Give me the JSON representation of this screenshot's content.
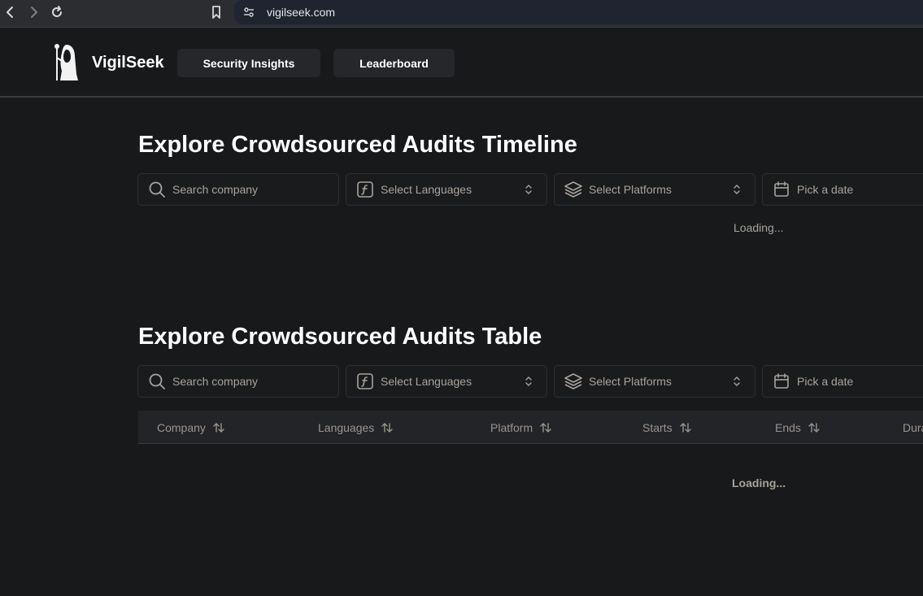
{
  "browser": {
    "url": "vigilseek.com"
  },
  "header": {
    "brand": "VigilSeek",
    "nav": [
      {
        "label": "Security Insights"
      },
      {
        "label": "Leaderboard"
      }
    ]
  },
  "timeline": {
    "title": "Explore Crowdsourced Audits Timeline",
    "search_placeholder": "Search company",
    "languages_label": "Select Languages",
    "platforms_label": "Select Platforms",
    "date_label": "Pick a date",
    "loading": "Loading..."
  },
  "table": {
    "title": "Explore Crowdsourced Audits Table",
    "search_placeholder": "Search company",
    "languages_label": "Select Languages",
    "platforms_label": "Select Platforms",
    "date_label": "Pick a date",
    "columns": [
      "Company",
      "Languages",
      "Platform",
      "Starts",
      "Ends",
      "Dura"
    ],
    "loading": "Loading..."
  },
  "icons": {
    "back": "chevron-left-icon",
    "forward": "chevron-right-icon",
    "reload": "reload-icon",
    "bookmark": "bookmark-icon",
    "site_settings": "site-settings-icon",
    "search": "search-icon",
    "languages": "function-icon",
    "platforms": "layers-icon",
    "date": "calendar-icon",
    "sort": "sort-icon"
  },
  "colors": {
    "background": "#18191b",
    "text_primary": "#ffffff",
    "text_muted": "#a8a39b"
  }
}
